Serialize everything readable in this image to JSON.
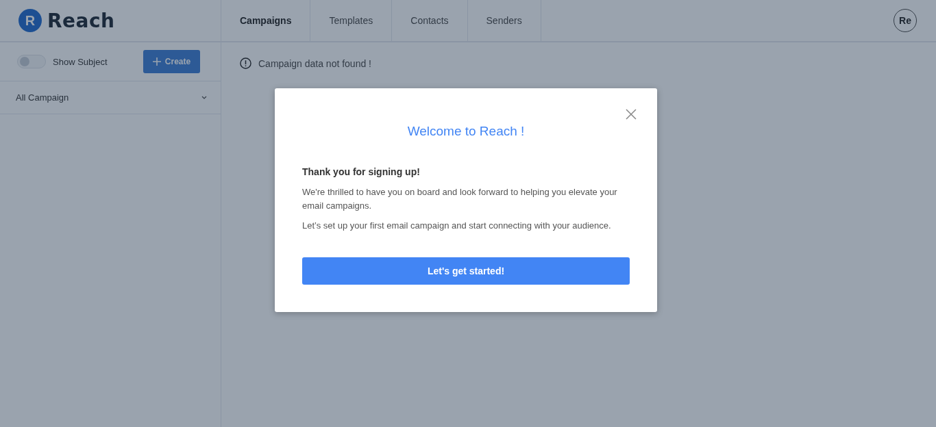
{
  "brand": {
    "logo_letter": "R",
    "name": "Reach"
  },
  "tabs": [
    {
      "label": "Campaigns",
      "selected": true
    },
    {
      "label": "Templates",
      "selected": false
    },
    {
      "label": "Contacts",
      "selected": false
    },
    {
      "label": "Senders",
      "selected": false
    }
  ],
  "user": {
    "initials": "Re"
  },
  "sidebar": {
    "toggle": {
      "label": "Show Subject",
      "on": false
    },
    "create_button": "Create",
    "filter": {
      "value": "All Campaign"
    }
  },
  "main": {
    "notice": "Campaign data not found !"
  },
  "modal": {
    "title": "Welcome to Reach !",
    "heading": "Thank you for signing up!",
    "paragraphs": [
      "We're thrilled to have you on board and look forward to helping you elevate your email campaigns.",
      "Let’s set up your first email campaign and start connecting with your audience."
    ],
    "button": "Let's get started!"
  }
}
